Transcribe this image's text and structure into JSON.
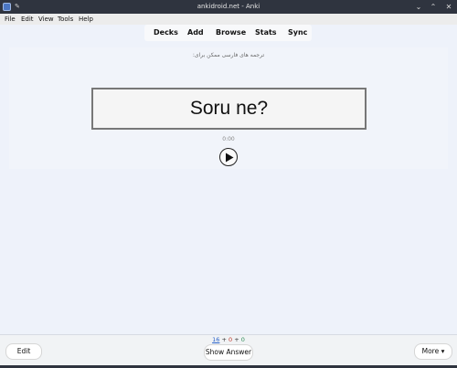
{
  "window": {
    "title": "ankidroid.net - Anki",
    "controls": {
      "minimize": "⌄",
      "maximize": "⌃",
      "close": "✕"
    },
    "icons": {
      "app": "anki-app-icon",
      "pin": "pin-icon"
    }
  },
  "menubar": {
    "items": [
      {
        "label": "File"
      },
      {
        "label": "Edit"
      },
      {
        "label": "View"
      },
      {
        "label": "Tools"
      },
      {
        "label": "Help"
      }
    ]
  },
  "toolbar": {
    "items": [
      {
        "label": "Decks"
      },
      {
        "label": "Add"
      },
      {
        "label": "Browse"
      },
      {
        "label": "Stats"
      },
      {
        "label": "Sync"
      }
    ]
  },
  "card": {
    "rtl_hint": "ترجمه های فارسی ممکن برای:",
    "question": "Soru ne?",
    "audio_time": "0:00",
    "play_icon": "play-icon"
  },
  "bottom": {
    "counts": {
      "new": "16",
      "sep1": "+",
      "learn": "0",
      "sep2": "+",
      "review": "0"
    },
    "edit_label": "Edit",
    "show_answer_label": "Show Answer",
    "more_label": "More ▾",
    "colors": {
      "new": "#2a62c9",
      "learn": "#c0392b",
      "review": "#2e8b57"
    }
  }
}
